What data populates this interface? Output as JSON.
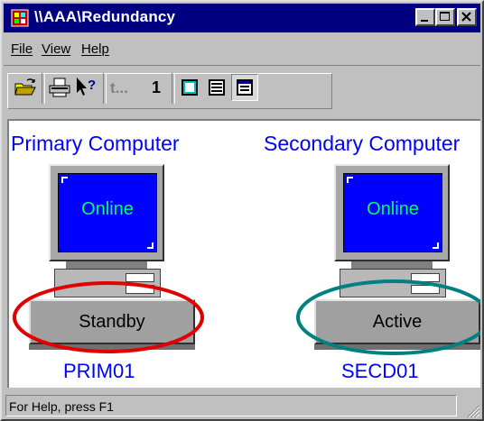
{
  "window": {
    "title": "\\\\AAA\\Redundancy"
  },
  "menu": {
    "items": [
      "File",
      "View",
      "Help"
    ]
  },
  "toolbar": {
    "tools": [
      "open-icon",
      "print-icon",
      "context-help-icon",
      "back-icon",
      "tile-view-icon",
      "list-view-icon",
      "detail-view-icon"
    ],
    "disabled_label": "t...",
    "number_label": "1"
  },
  "primary": {
    "title": "Primary Computer",
    "screen_status": "Online",
    "role": "Standby",
    "name": "PRIM01",
    "highlight_color": "#e00000"
  },
  "secondary": {
    "title": "Secondary Computer",
    "screen_status": "Online",
    "role": "Active",
    "name": "SECD01",
    "highlight_color": "#008080"
  },
  "status": {
    "text": "For Help, press F1"
  },
  "colors": {
    "title_bar": "#000080",
    "label_blue": "#0000ff",
    "screen_blue": "#0000ff",
    "screen_text": "#00ff66"
  }
}
